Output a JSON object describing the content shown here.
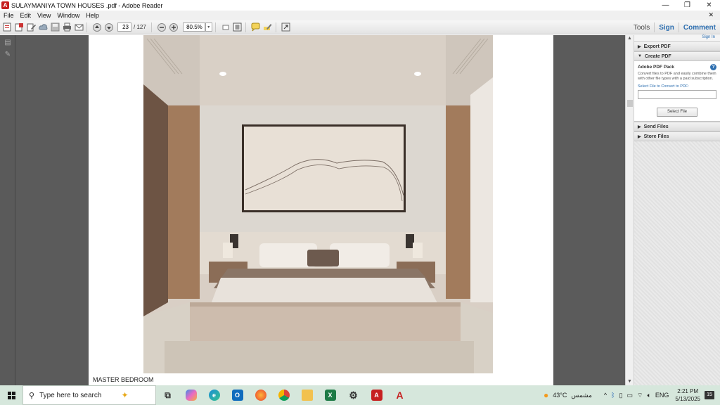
{
  "window": {
    "title": "SULAYMANIYA TOWN HOUSES .pdf - Adobe Reader",
    "minimize": "—",
    "maximize": "❐",
    "close": "✕"
  },
  "menu": {
    "items": [
      "File",
      "Edit",
      "View",
      "Window",
      "Help"
    ],
    "close_doc": "✕"
  },
  "toolbar": {
    "page_current": "23",
    "page_separator": "/ 127",
    "zoom_value": "80.5%",
    "tools_label": "Tools",
    "sign_label": "Sign",
    "comment_label": "Comment"
  },
  "document": {
    "caption": "MASTER BEDROOM"
  },
  "right_panel": {
    "sign_in": "Sign In",
    "sections": {
      "export_pdf": "Export PDF",
      "create_pdf": "Create PDF",
      "send_files": "Send Files",
      "store_files": "Store Files"
    },
    "create_pdf": {
      "pack_title": "Adobe PDF Pack",
      "description": "Convert files to PDF and easily combine them with other file types with a paid subscription.",
      "select_label": "Select File to Convert to PDF:",
      "select_button": "Select File"
    }
  },
  "taskbar": {
    "search_placeholder": "Type here to search",
    "weather_temp": "43°C",
    "weather_text": "مشمس",
    "language": "ENG",
    "time": "2:21 PM",
    "date": "5/13/2025",
    "notification_count": "15"
  },
  "colors": {
    "accent_blue": "#2e6fb0",
    "taskbar": "#d6e7dc",
    "doc_background": "#5b5b5b"
  }
}
